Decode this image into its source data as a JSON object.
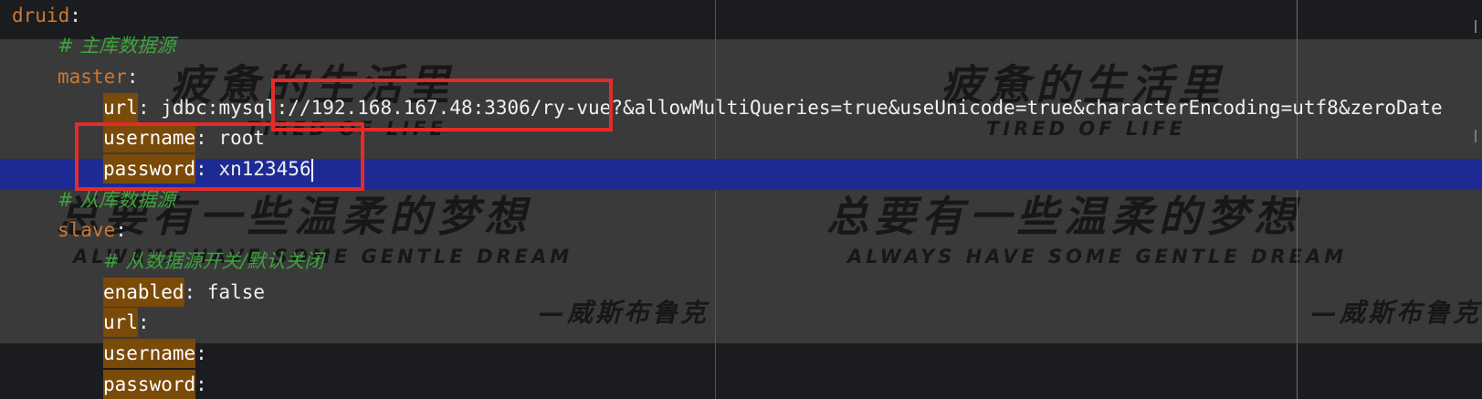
{
  "wallpaper": {
    "headline": "疲惫的生活里",
    "headline_en": "TIRED OF LIFE",
    "dream": "总要有一些温柔的梦想",
    "dream_en": "ALWAYS HAVE SOME GENTLE DREAM",
    "signature": "—威斯布鲁克"
  },
  "code": {
    "druid_key": "druid",
    "comment_master": "# 主库数据源",
    "master_key": "master",
    "url_key": "url",
    "url_value": "jdbc:mysql://192.168.167.48:3306/ry-vue?&allowMultiQueries=true&useUnicode=true&characterEncoding=utf8&zeroDate",
    "username_key": "username",
    "username_value": "root",
    "password_key": "password",
    "password_value": "xn123456",
    "comment_slave": "# 从库数据源",
    "slave_key": "slave",
    "comment_switch": "# 从数据源开关/默认关闭",
    "enabled_key": "enabled",
    "enabled_value": "false",
    "slave_url_key": "url",
    "slave_username_key": "username",
    "slave_password_key": "password"
  },
  "colors": {
    "keyword": "#cc7832",
    "comment": "#3ea33e",
    "current_line": "#1e2a94",
    "highlight_box": "#e52a2a"
  }
}
